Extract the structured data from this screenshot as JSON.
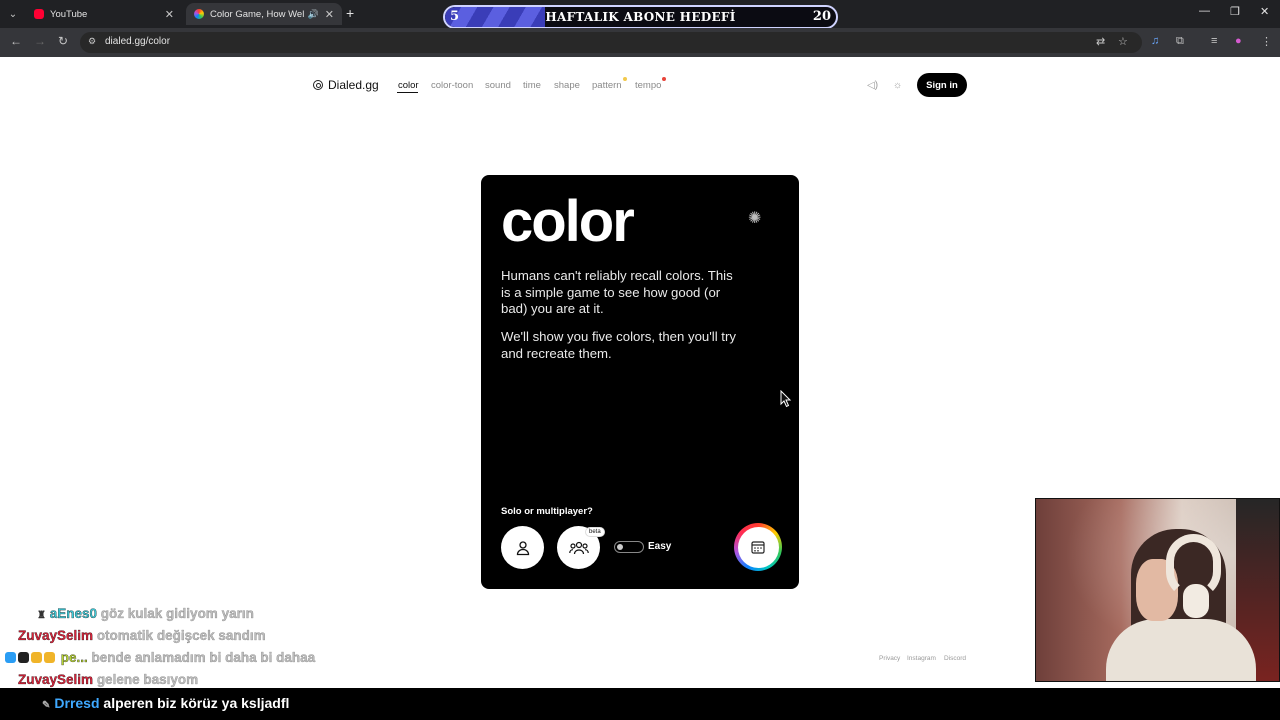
{
  "browser": {
    "tabs": [
      {
        "title": "YouTube"
      },
      {
        "title": "Color Game, How Well Can"
      }
    ],
    "url": "dialed.gg/color",
    "goal_overlay": {
      "start": "5",
      "title": "HAFTALIK ABONE HEDEFİ",
      "end": "20"
    }
  },
  "site": {
    "logo": "Dialed.gg",
    "nav": [
      "color",
      "color-toon",
      "sound",
      "time",
      "shape",
      "pattern",
      "tempo"
    ],
    "active_nav": "color",
    "signin_label": "Sign in",
    "footer": [
      "Privacy",
      "Instagram",
      "Discord"
    ]
  },
  "card": {
    "title": "color",
    "paragraph1": "Humans can't reliably recall colors. This is a simple game to see how good (or bad) you are at it.",
    "paragraph2": "We'll show you five colors, then you'll try and recreate them.",
    "mode_label": "Solo or multiplayer?",
    "beta_label": "beta",
    "difficulty": "Easy"
  },
  "chat": [
    {
      "user": "aEnes0",
      "user_color": "#3ec8d6",
      "message": "göz kulak gidiyom yarın"
    },
    {
      "user": "ZuvaySelim",
      "user_color": "#d9233a",
      "message": "otomatik değişcek sandım"
    },
    {
      "user": "pe...",
      "user_color": "#b7d433",
      "message": "bende anlamadım bi daha bi dahaa"
    },
    {
      "user": "ZuvaySelim",
      "user_color": "#d9233a",
      "message": "gelene basıyom"
    }
  ],
  "bottom_chat": {
    "user": "Drresd",
    "message": "alperen biz körüz ya ksljadfl"
  }
}
